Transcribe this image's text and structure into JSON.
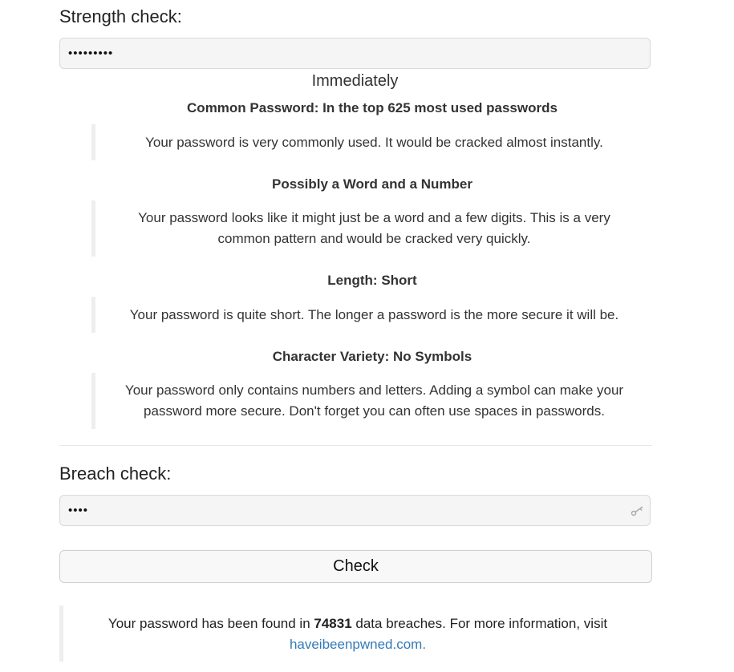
{
  "strength": {
    "label": "Strength check:",
    "password_masked": "•••••••••",
    "crack_time": "Immediately",
    "feedback": [
      {
        "title": "Common Password: In the top 625 most used passwords",
        "text": "Your password is very commonly used. It would be cracked almost instantly."
      },
      {
        "title": "Possibly a Word and a Number",
        "text": "Your password looks like it might just be a word and a few digits. This is a very common pattern and would be cracked very quickly."
      },
      {
        "title": "Length: Short",
        "text": "Your password is quite short. The longer a password is the more secure it will be."
      },
      {
        "title": "Character Variety: No Symbols",
        "text": "Your password only contains numbers and letters. Adding a symbol can make your password more secure. Don't forget you can often use spaces in passwords."
      }
    ]
  },
  "breach": {
    "label": "Breach check:",
    "password_masked": "••••",
    "check_button": "Check",
    "result_prefix": "Your password has been found in ",
    "result_count": "74831",
    "result_suffix": " data breaches. For more information, visit",
    "link_text": "haveibeenpwned.com."
  },
  "icons": {
    "password_manager": "key-icon"
  },
  "colors": {
    "link": "#337ab7",
    "field_bg": "#f5f5f5",
    "quote_border": "#eeeeee"
  }
}
